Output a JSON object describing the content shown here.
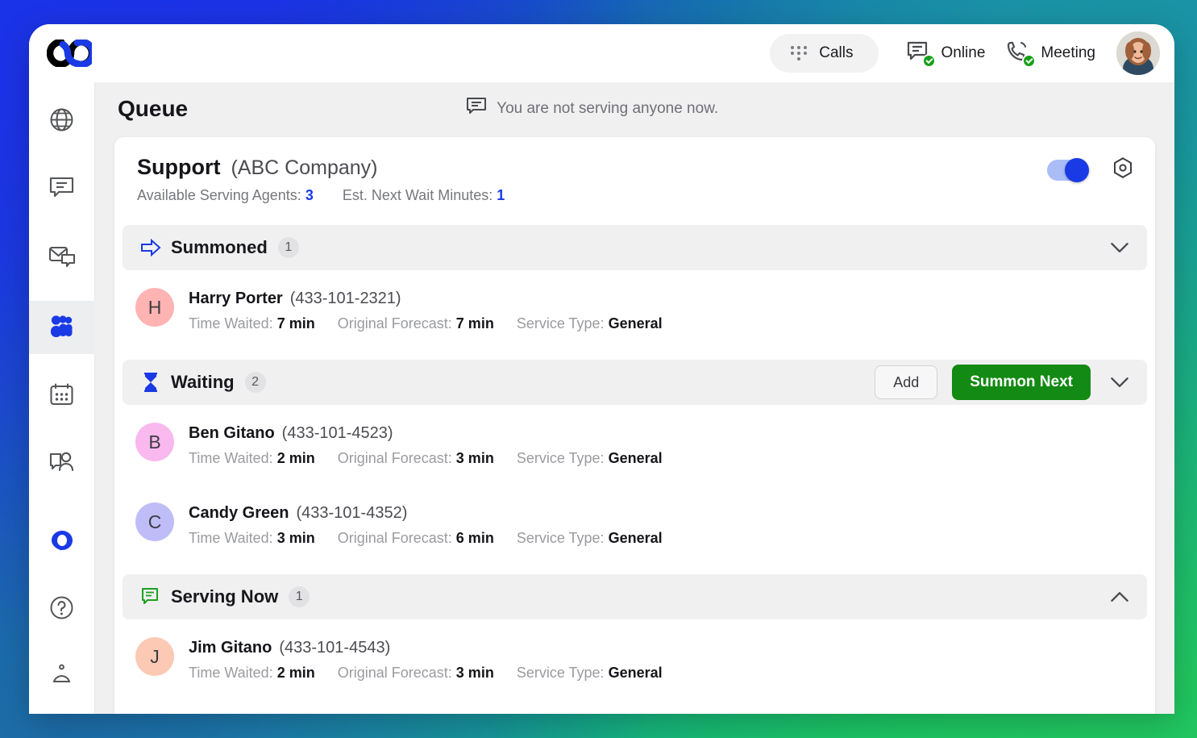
{
  "topbar": {
    "logo_name": "8x8-logo",
    "calls_label": "Calls",
    "status_online": "Online",
    "status_meeting": "Meeting"
  },
  "sidebar": {
    "items": [
      {
        "name": "globe",
        "label": "Globe",
        "active": false
      },
      {
        "name": "chat",
        "label": "Chat",
        "active": false
      },
      {
        "name": "mail",
        "label": "Mail",
        "active": false
      },
      {
        "name": "contacts",
        "label": "Contacts",
        "active": true
      },
      {
        "name": "calendar",
        "label": "Calendar",
        "active": false
      },
      {
        "name": "support-chat",
        "label": "Support Chat",
        "active": false
      }
    ],
    "bottom_items": [
      {
        "name": "assistant",
        "label": "Assistant"
      },
      {
        "name": "help",
        "label": "Help"
      },
      {
        "name": "more",
        "label": "More"
      }
    ]
  },
  "page": {
    "title": "Queue",
    "serving_note": "You are not serving anyone now."
  },
  "queue": {
    "name": "Support",
    "company": "(ABC Company)",
    "available_agents_label": "Available Serving Agents:",
    "available_agents_value": "3",
    "est_wait_label": "Est. Next Wait Minutes:",
    "est_wait_value": "1",
    "toggle_on": true
  },
  "labels": {
    "time_waited": "Time Waited:",
    "original_forecast": "Original Forecast:",
    "service_type": "Service Type:"
  },
  "colors": {
    "accent_blue": "#1a3ae5",
    "summon_green": "#138a13",
    "serving_green": "#20a020"
  },
  "sections": [
    {
      "id": "summoned",
      "icon": "arrow-right-icon",
      "title": "Summoned",
      "count": "1",
      "expanded": true,
      "chevron": "down",
      "buttons": [],
      "people": [
        {
          "initial": "H",
          "avatar_color": "#ffb3b3",
          "name": "Harry Porter",
          "phone": "(433-101-2321)",
          "time_waited": "7 min",
          "original_forecast": "7 min",
          "service_type": "General"
        }
      ]
    },
    {
      "id": "waiting",
      "icon": "hourglass-icon",
      "title": "Waiting",
      "count": "2",
      "expanded": true,
      "chevron": "down",
      "buttons": [
        {
          "name": "add-button",
          "label": "Add",
          "style": "secondary"
        },
        {
          "name": "summon-next-button",
          "label": "Summon Next",
          "style": "primary-green"
        }
      ],
      "people": [
        {
          "initial": "B",
          "avatar_color": "#f9b8ee",
          "name": "Ben Gitano",
          "phone": "(433-101-4523)",
          "time_waited": "2 min",
          "original_forecast": "3 min",
          "service_type": "General"
        },
        {
          "initial": "C",
          "avatar_color": "#bfbdf7",
          "name": "Candy Green",
          "phone": "(433-101-4352)",
          "time_waited": "3 min",
          "original_forecast": "6 min",
          "service_type": "General"
        }
      ]
    },
    {
      "id": "serving-now",
      "icon": "chat-green-icon",
      "title": "Serving Now",
      "count": "1",
      "expanded": true,
      "chevron": "up",
      "buttons": [],
      "people": [
        {
          "initial": "J",
          "avatar_color": "#fcc9b4",
          "name": "Jim Gitano",
          "phone": "(433-101-4543)",
          "time_waited": "2 min",
          "original_forecast": "3 min",
          "service_type": "General"
        }
      ]
    }
  ]
}
